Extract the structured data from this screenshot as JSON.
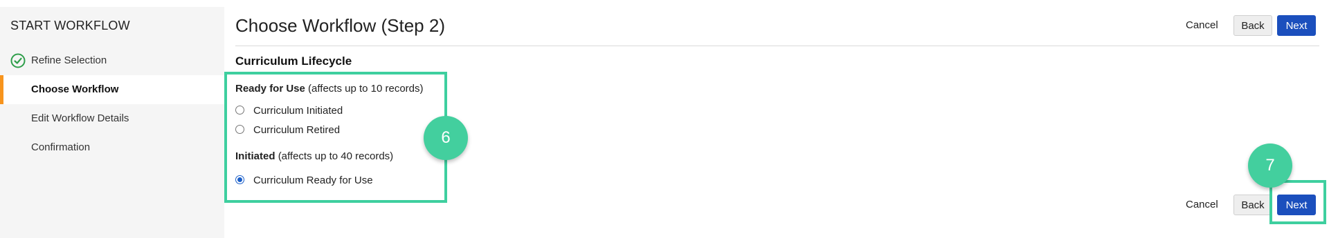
{
  "sidebar": {
    "title": "START WORKFLOW",
    "steps": [
      {
        "label": "Refine Selection",
        "state": "completed",
        "icon": "check-circle-icon"
      },
      {
        "label": "Choose Workflow",
        "state": "active"
      },
      {
        "label": "Edit Workflow Details",
        "state": "pending"
      },
      {
        "label": "Confirmation",
        "state": "pending"
      }
    ]
  },
  "header": {
    "title": "Choose Workflow (Step 2)",
    "cancel_label": "Cancel",
    "back_label": "Back",
    "next_label": "Next"
  },
  "main": {
    "section_title": "Curriculum Lifecycle",
    "groups": [
      {
        "name": "Ready for Use",
        "note": "(affects up to 10 records)",
        "options": [
          {
            "label": "Curriculum Initiated",
            "checked": false
          },
          {
            "label": "Curriculum Retired",
            "checked": false
          }
        ]
      },
      {
        "name": "Initiated",
        "note": "(affects up to 40 records)",
        "options": [
          {
            "label": "Curriculum Ready for Use",
            "checked": true
          }
        ]
      }
    ]
  },
  "footer": {
    "cancel_label": "Cancel",
    "back_label": "Back",
    "next_label": "Next"
  },
  "callouts": [
    {
      "number": "6"
    },
    {
      "number": "7"
    }
  ],
  "colors": {
    "accent_orange": "#f7941d",
    "primary_blue": "#1b4fbd",
    "callout_green": "#43cf9e",
    "check_green": "#2e9e4a"
  }
}
